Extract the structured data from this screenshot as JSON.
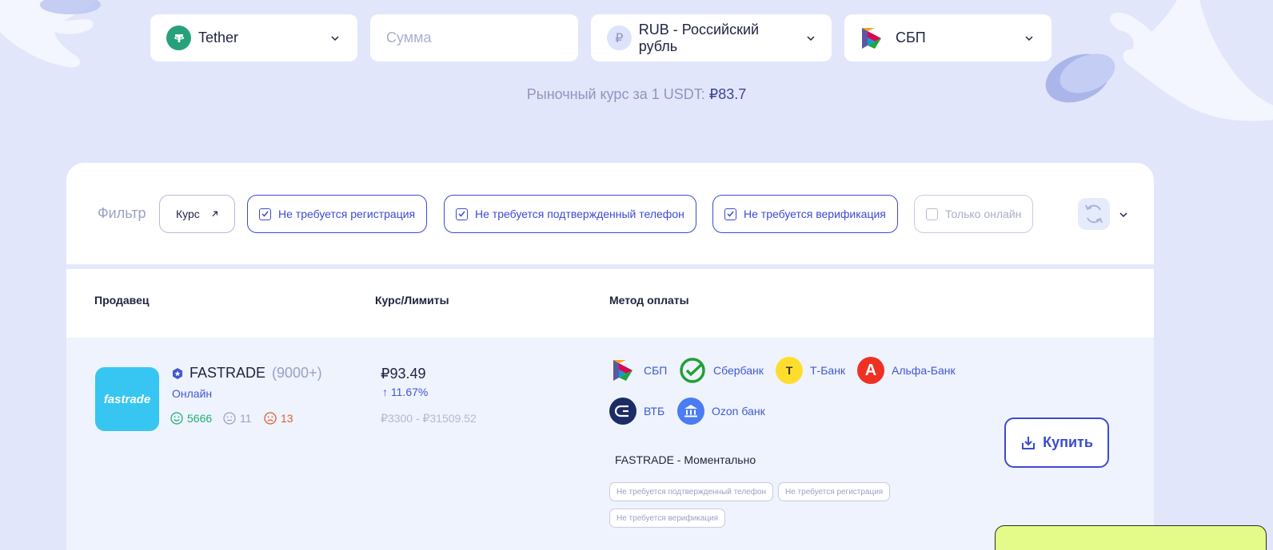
{
  "currency_select": {
    "name": "Tether",
    "icon": "tether-icon",
    "color": "#26a17b"
  },
  "amount": {
    "placeholder": "Сумма",
    "value": ""
  },
  "fiat_select": {
    "label": "RUB - Российский рубль",
    "icon": "ruble-icon"
  },
  "payment_select": {
    "label": "СБП",
    "icon": "sbp-icon"
  },
  "market_rate": {
    "label": "Рыночный курс за 1 USDT:",
    "value": "₽83.7"
  },
  "filters": {
    "label": "Фильтр",
    "sort": {
      "label": "Курс",
      "icon": "arrow-up-right-icon"
    },
    "chips": [
      {
        "label": "Не требуется регистрация",
        "checked": true
      },
      {
        "label": "Не требуется подтвержденный телефон",
        "checked": true
      },
      {
        "label": "Не требуется верификация",
        "checked": true
      },
      {
        "label": "Только онлайн",
        "checked": false
      }
    ]
  },
  "table": {
    "headers": {
      "seller": "Продавец",
      "rate": "Курс/Лимиты",
      "method": "Метод оплаты"
    }
  },
  "offer": {
    "seller": {
      "name": "FASTRADE",
      "count": "(9000+)",
      "status": "Онлайн",
      "logo_text": "fastrade"
    },
    "feedback": {
      "positive": "5666",
      "neutral": "11",
      "negative": "13"
    },
    "price": "₽93.49",
    "change": "11.67%",
    "limits": "₽3300 - ₽31509.52",
    "methods": [
      "СБП",
      "Сбербанк",
      "Т-Банк",
      "Альфа-Банк",
      "ВТБ",
      "Ozon банк"
    ],
    "description": "FASTRADE - Моментально",
    "tags": [
      "Не требуется подтвержденный телефон",
      "Не требуется регистрация",
      "Не требуется верификация"
    ],
    "buy_label": "Купить"
  },
  "colors": {
    "accent": "#3b4bd1",
    "background": "#e2e6fb",
    "positive": "#22b070",
    "negative": "#e35d2f"
  }
}
